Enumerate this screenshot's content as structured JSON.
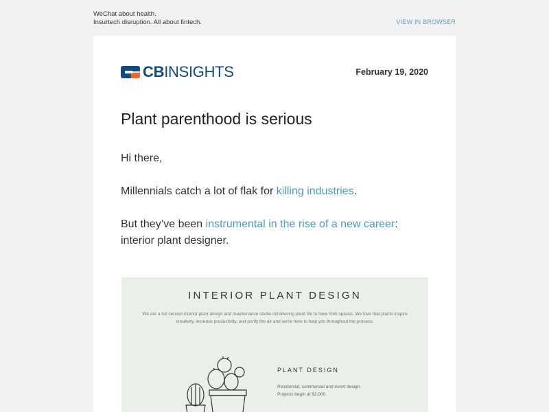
{
  "preheader": {
    "line1": "WeChat about health.",
    "line2": "Insurtech disruption. All about fintech.",
    "view_in_browser": "VIEW IN BROWSER"
  },
  "brand": {
    "name_bold": "CB",
    "name_light": "INSIGHTS",
    "primary_color": "#0f4c81",
    "accent_color": "#f26522"
  },
  "email": {
    "date": "February 19, 2020",
    "title": "Plant parenthood is serious",
    "greeting": "Hi there,",
    "p2_before": "Millennials catch a lot of flak for ",
    "p2_link": "killing industries",
    "p2_after": ".",
    "p3_before": "But they’ve been ",
    "p3_link": "instrumental in the rise of a new career",
    "p3_after": ": interior plant designer.",
    "link_color": "#4a9dc2"
  },
  "hero": {
    "title": "INTERIOR PLANT DESIGN",
    "description": "We are a full service interior plant design and maintenance studio introducing plant life to New York spaces. We love that plants inspire creativity, increase productivity, and purify the air and we're here to help you throughout the process.",
    "service_title": "PLANT DESIGN",
    "service_line1": "Residential, commercial and event design.",
    "service_line2": "Projects begin at $2,000.",
    "background": "#e9f0e8"
  }
}
